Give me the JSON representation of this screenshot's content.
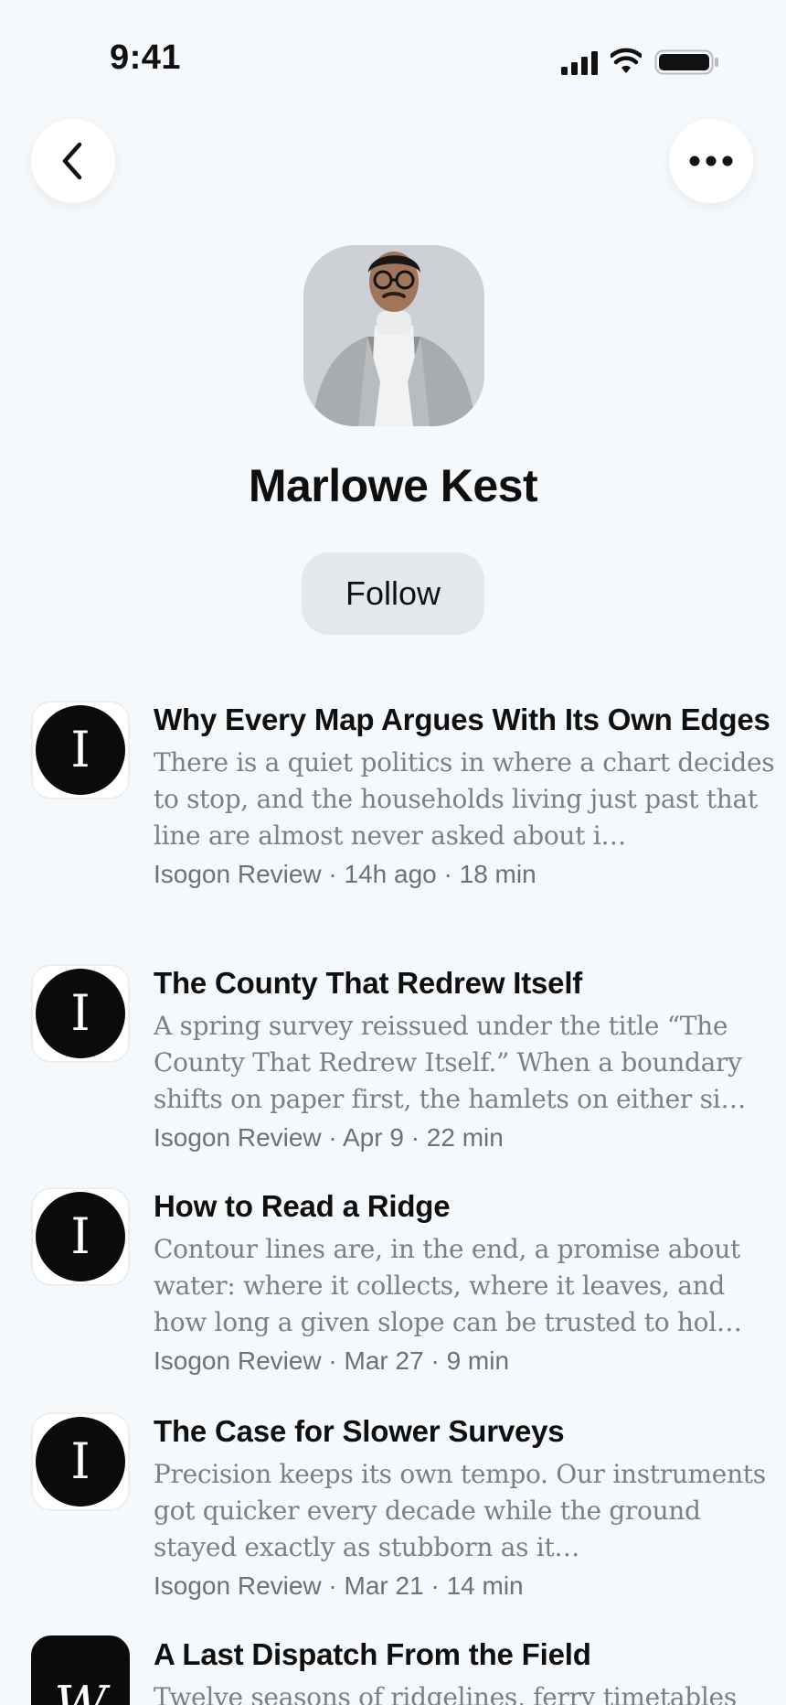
{
  "status_bar": {
    "time": "9:41"
  },
  "profile": {
    "name": "Marlowe Kest",
    "follow_label": "Follow"
  },
  "icons": {
    "back": "chevron-left-icon",
    "more": "ellipsis-icon",
    "signal": "cellular-signal-icon",
    "wifi": "wifi-icon",
    "battery": "battery-icon"
  },
  "articles": [
    {
      "logo_letter": "I",
      "title": "Why Every Map Argues With Its Own Edges",
      "excerpt": "There is a quiet politics in where a chart decides to stop, and the households living just past that line are almost never asked about i…",
      "meta": "Isogon Review · 14h ago · 18 min"
    },
    {
      "logo_letter": "I",
      "title": "The County That Redrew Itself",
      "excerpt": "A spring survey reissued under the title “The County That Redrew Itself.” When a boundary shifts on paper first, the hamlets on either si…",
      "meta": "Isogon Review · Apr 9 · 22 min"
    },
    {
      "logo_letter": "I",
      "title": "How to Read a Ridge",
      "excerpt": "Contour lines are, in the end, a promise about water: where it collects, where it leaves, and how long a given slope can be trusted to hol…",
      "meta": "Isogon Review · Mar 27 · 9 min"
    },
    {
      "logo_letter": "I",
      "title": "The Case for Slower Surveys",
      "excerpt": "Precision keeps its own tempo. Our instruments got quicker every decade while the ground stayed exactly as stubborn as it…",
      "meta": "Isogon Review · Mar 21 · 14 min"
    },
    {
      "logo_letter": "W",
      "title": "A Last Dispatch From the Field",
      "excerpt": "Twelve seasons of ridgelines, ferry timetables",
      "meta": ""
    }
  ],
  "colors": {
    "background": "#f6f9fc",
    "follow_button": "#e3e8ec",
    "excerpt_text": "#7d7f82",
    "logo_dark": "#0b0b0b"
  }
}
